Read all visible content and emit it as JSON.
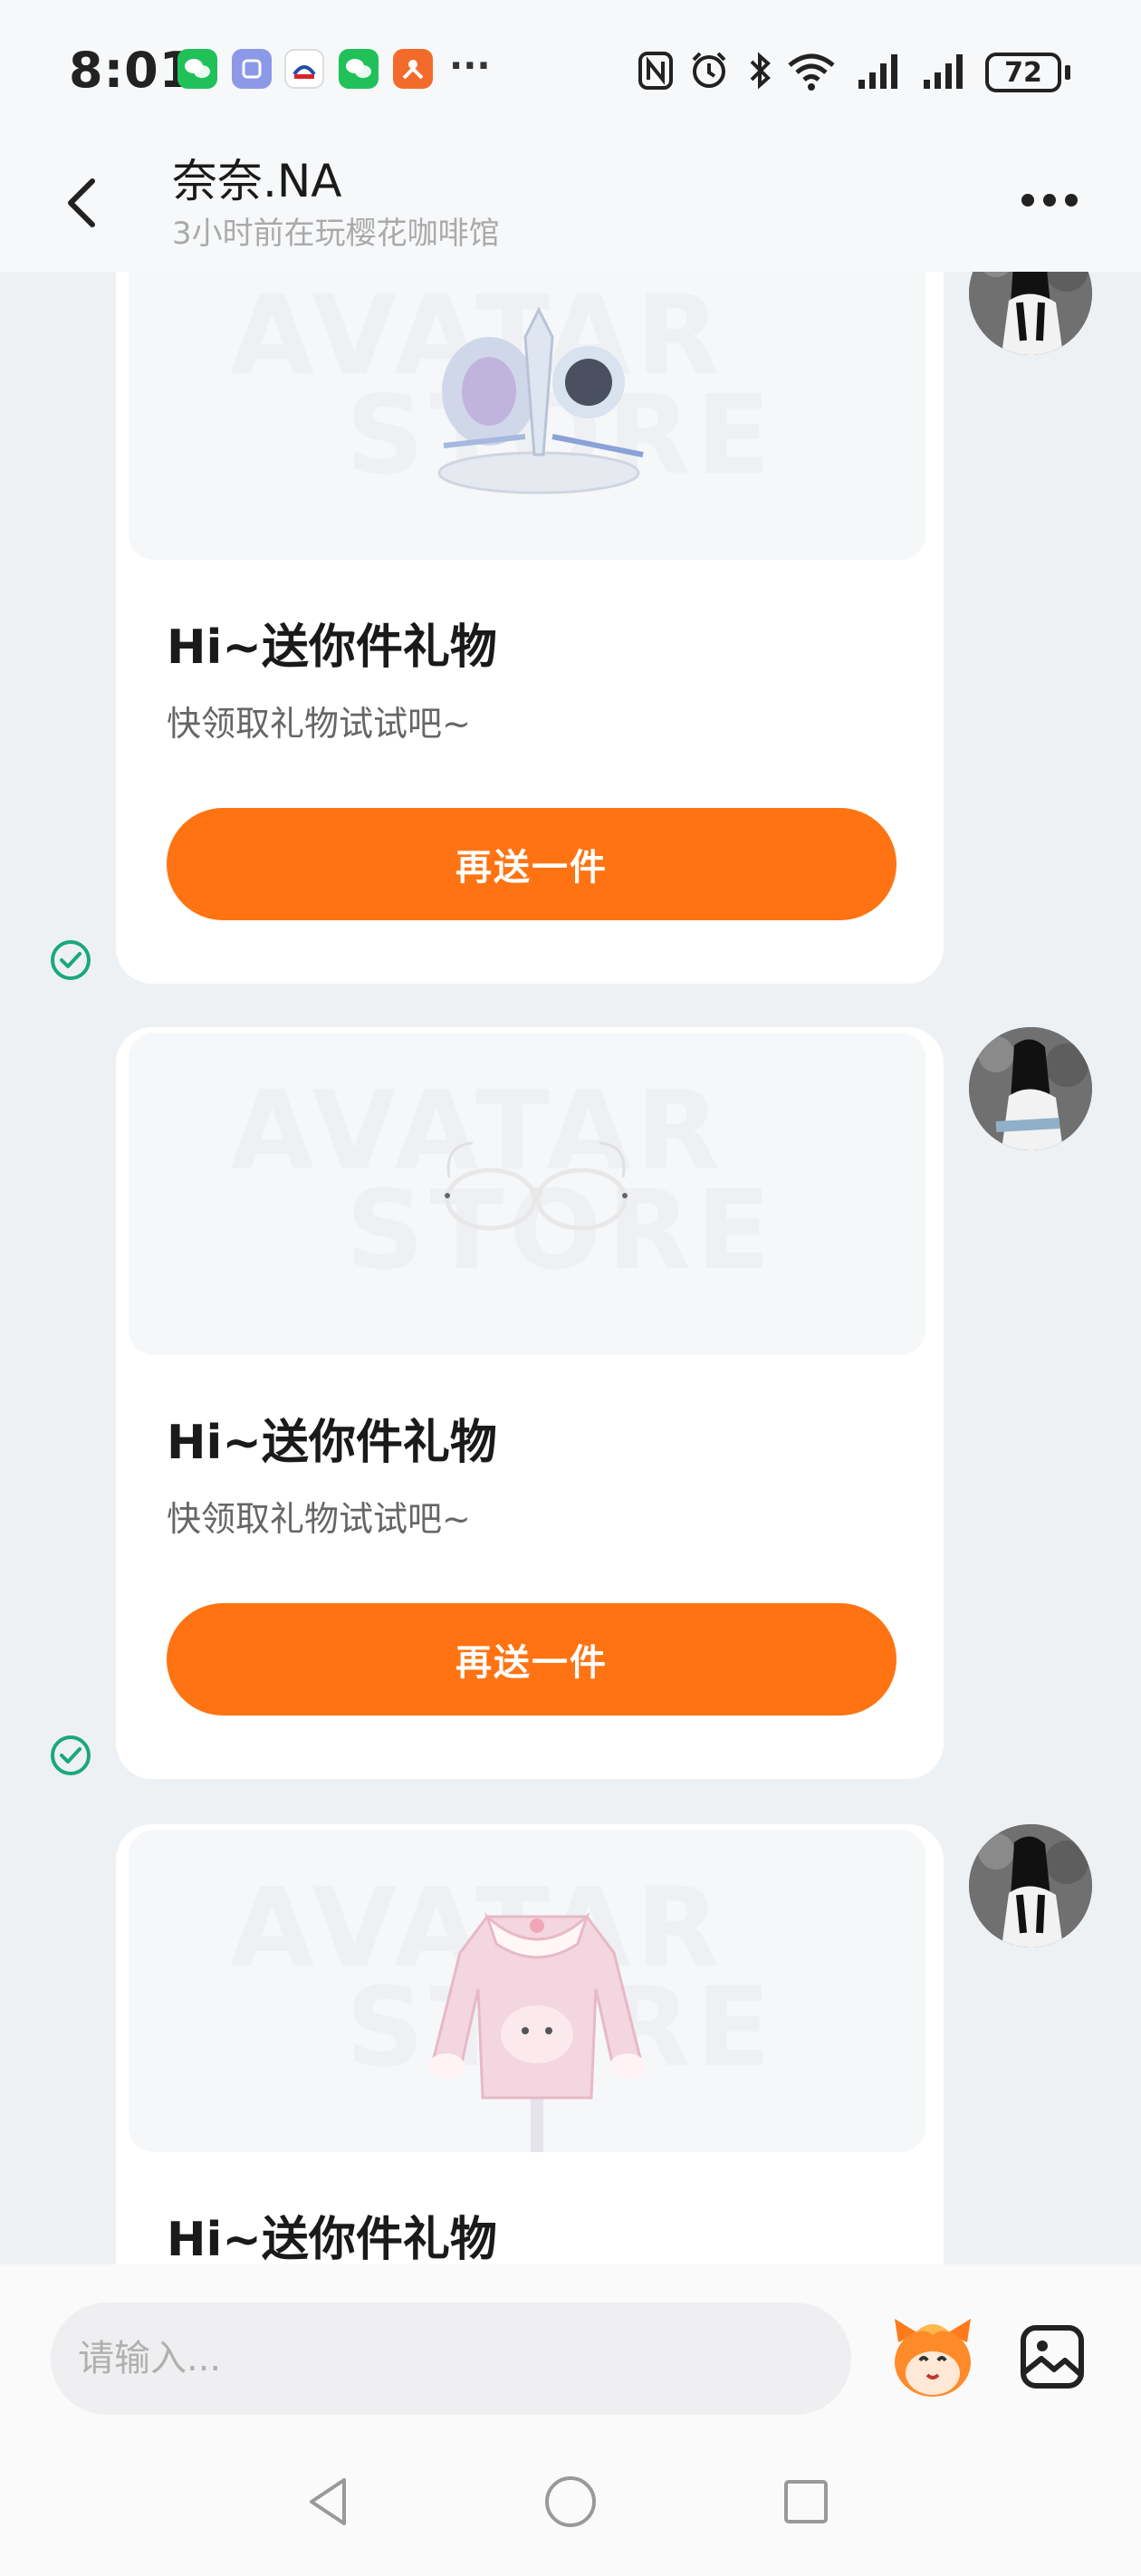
{
  "status_bar": {
    "time": "8:01",
    "battery": "72",
    "notification_icons": [
      "wechat-icon",
      "app-icon",
      "railway-icon",
      "wechat-icon",
      "orange-app-icon"
    ],
    "more_notifications": "···"
  },
  "header": {
    "name": "奈奈.NA",
    "status": "3小时前在玩樱花咖啡馆"
  },
  "messages": [
    {
      "title": "Hi~送你件礼物",
      "subtitle": "快领取礼物试试吧~",
      "button": "再送一件",
      "gift": "accessory",
      "read": true
    },
    {
      "title": "Hi~送你件礼物",
      "subtitle": "快领取礼物试试吧~",
      "button": "再送一件",
      "gift": "glasses",
      "read": true
    },
    {
      "title": "Hi~送你件礼物",
      "subtitle": "",
      "button": "",
      "gift": "pink-jacket",
      "read": false
    }
  ],
  "watermark": [
    "AVATAR",
    "STORE"
  ],
  "input": {
    "placeholder": "请输入..."
  },
  "colors": {
    "accent": "#ff7312",
    "read_check": "#1aa87a",
    "background": "#eef1f4"
  }
}
